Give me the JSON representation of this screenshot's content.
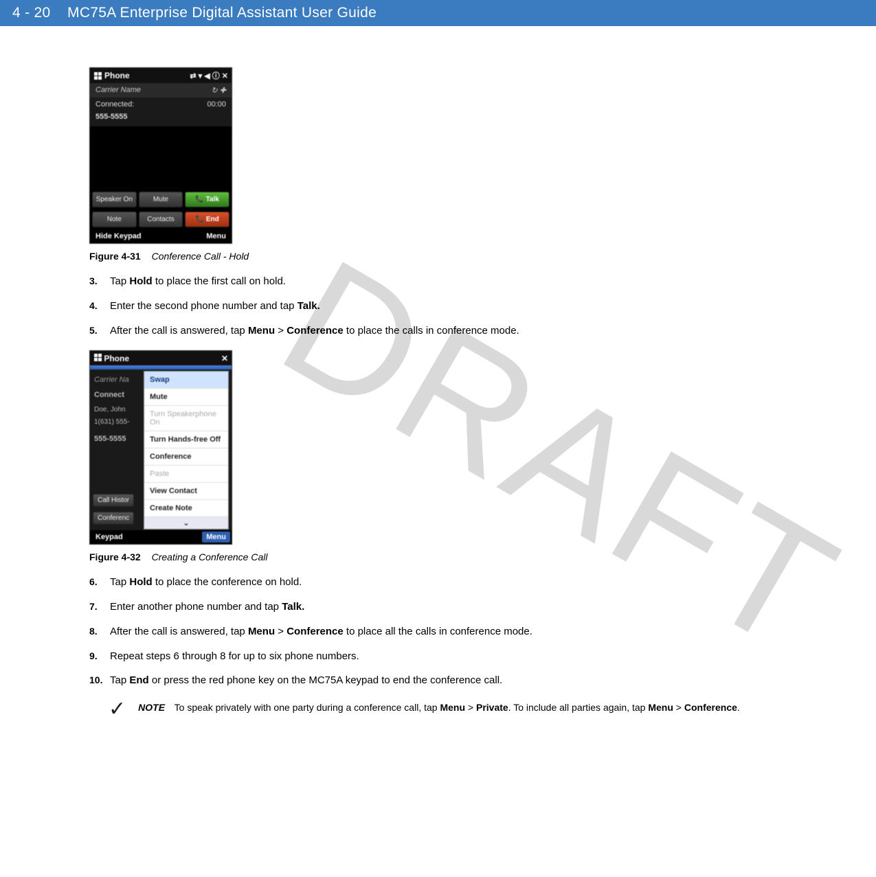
{
  "header": {
    "page_num": "4 - 20",
    "title": "MC75A Enterprise Digital Assistant User Guide"
  },
  "watermark": "DRAFT",
  "phone1": {
    "title": "Phone",
    "status_icons": "⇄ ▾ ◀ ⓘ ✕",
    "carrier": "Carrier Name",
    "carrier_icon": "↻ ✚",
    "connected": "Connected:",
    "time": "00:00",
    "number": "555-5555",
    "btn_speaker": "Speaker On",
    "btn_mute": "Mute",
    "btn_talk": "📞 Talk",
    "btn_note": "Note",
    "btn_contacts": "Contacts",
    "btn_end": "📞 End",
    "bottom_left": "Hide Keypad",
    "bottom_right": "Menu"
  },
  "fig1": {
    "label": "Figure 4-31",
    "title": "Conference Call - Hold"
  },
  "steps_a": {
    "3": {
      "pre": "Tap ",
      "b1": "Hold",
      "post": " to place the first call on hold."
    },
    "4": {
      "pre": "Enter the second phone number and tap ",
      "b1": "Talk."
    },
    "5": {
      "pre": "After the call is answered, tap ",
      "b1": "Menu",
      "mid1": " > ",
      "b2": "Conference",
      "post": " to place the calls in conference mode."
    }
  },
  "phone2": {
    "title": "Phone",
    "close": "✕",
    "left": {
      "carrier": "Carrier Na",
      "connect": "Connect",
      "caller": "Doe, John\n1(631) 555-",
      "dialed": "555-5555",
      "callhist": "Call Histor",
      "conf": "Conferenc"
    },
    "menu": {
      "swap": "Swap",
      "mute": "Mute",
      "speaker": "Turn Speakerphone On",
      "handsfree": "Turn Hands-free Off",
      "conference": "Conference",
      "paste": "Paste",
      "viewcontact": "View Contact",
      "createnote": "Create Note",
      "arrow": "⌄"
    },
    "bottom_left": "Keypad",
    "bottom_right": "Menu"
  },
  "fig2": {
    "label": "Figure 4-32",
    "title": "Creating a Conference Call"
  },
  "steps_b": {
    "6": {
      "pre": "Tap ",
      "b1": "Hold",
      "post": " to place the conference on hold."
    },
    "7": {
      "pre": "Enter another phone number and tap ",
      "b1": "Talk."
    },
    "8": {
      "pre": "After the call is answered, tap ",
      "b1": "Menu",
      "mid1": " > ",
      "b2": "Conference",
      "post": " to place all the calls in conference mode."
    },
    "9": {
      "txt": "Repeat steps 6 through 8 for up to six phone numbers."
    },
    "10": {
      "pre": "Tap ",
      "b1": "End",
      "post": " or press the red phone key on the MC75A keypad to end the conference call."
    }
  },
  "note": {
    "label": "NOTE",
    "text_pre": "To speak privately with one party during a conference call, tap ",
    "b1": "Menu",
    "mid1": " > ",
    "b2": "Private",
    "text_mid": ". To include all parties again, tap ",
    "b3": "Menu",
    "mid2": " > ",
    "b4": "Conference",
    "text_post": "."
  }
}
